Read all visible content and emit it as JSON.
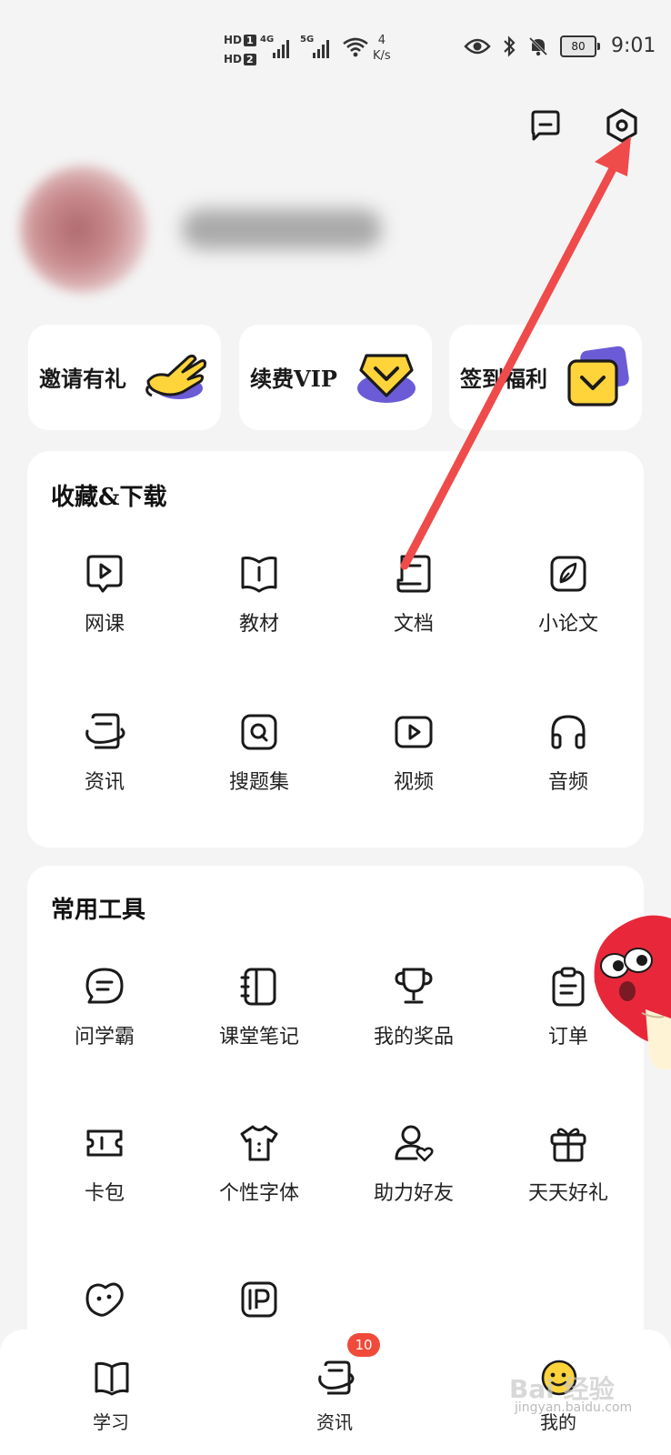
{
  "status_bar": {
    "hd1": "HD",
    "hd1_sim": "1",
    "hd2": "HD",
    "hd2_sim": "2",
    "net1": "4G",
    "net2": "5G",
    "speed_value": "4",
    "speed_unit": "K/s",
    "battery": "80",
    "time": "9:01",
    "icons": [
      "eye-icon",
      "bluetooth-icon",
      "bell-off-icon",
      "battery-icon"
    ]
  },
  "header": {
    "icons": [
      "message-icon",
      "settings-icon"
    ]
  },
  "promos": [
    {
      "label": "邀请有礼",
      "icon": "waving-hand-icon"
    },
    {
      "label": "续费VIP",
      "icon": "vip-badge-icon"
    },
    {
      "label": "签到福利",
      "icon": "checkin-card-icon"
    }
  ],
  "collect": {
    "title": "收藏&下载",
    "items": [
      {
        "label": "网课",
        "icon": "play-bubble-icon"
      },
      {
        "label": "教材",
        "icon": "book-icon"
      },
      {
        "label": "文档",
        "icon": "document-icon"
      },
      {
        "label": "小论文",
        "icon": "pen-icon"
      },
      {
        "label": "资讯",
        "icon": "news-icon"
      },
      {
        "label": "搜题集",
        "icon": "search-question-icon"
      },
      {
        "label": "视频",
        "icon": "video-icon"
      },
      {
        "label": "音频",
        "icon": "headphones-icon"
      }
    ]
  },
  "tools": {
    "title": "常用工具",
    "items": [
      {
        "label": "问学霸",
        "icon": "chat-icon"
      },
      {
        "label": "课堂笔记",
        "icon": "notebook-icon"
      },
      {
        "label": "我的奖品",
        "icon": "trophy-icon"
      },
      {
        "label": "订单",
        "icon": "clipboard-icon"
      },
      {
        "label": "卡包",
        "icon": "ticket-icon"
      },
      {
        "label": "个性字体",
        "icon": "tshirt-icon"
      },
      {
        "label": "助力好友",
        "icon": "user-heart-icon"
      },
      {
        "label": "天天好礼",
        "icon": "gift-icon"
      },
      {
        "label": "",
        "icon": "heart-face-icon"
      },
      {
        "label": "",
        "icon": "parking-card-icon"
      }
    ]
  },
  "bottom_nav": {
    "tabs": [
      {
        "label": "学习",
        "icon": "book-tab-icon"
      },
      {
        "label": "资讯",
        "icon": "news-tab-icon",
        "badge": "10"
      },
      {
        "label": "我的",
        "icon": "smiley-tab-icon"
      }
    ]
  },
  "watermark": {
    "brand": "Bai 经验",
    "url": "jingyan.baidu.com"
  },
  "colors": {
    "background": "#f4f4f4",
    "card": "#ffffff",
    "accent_yellow": "#ffd43b",
    "accent_purple": "#6b5bd6",
    "badge_red": "#f04a3a",
    "arrow_red": "#ef4b4b"
  }
}
